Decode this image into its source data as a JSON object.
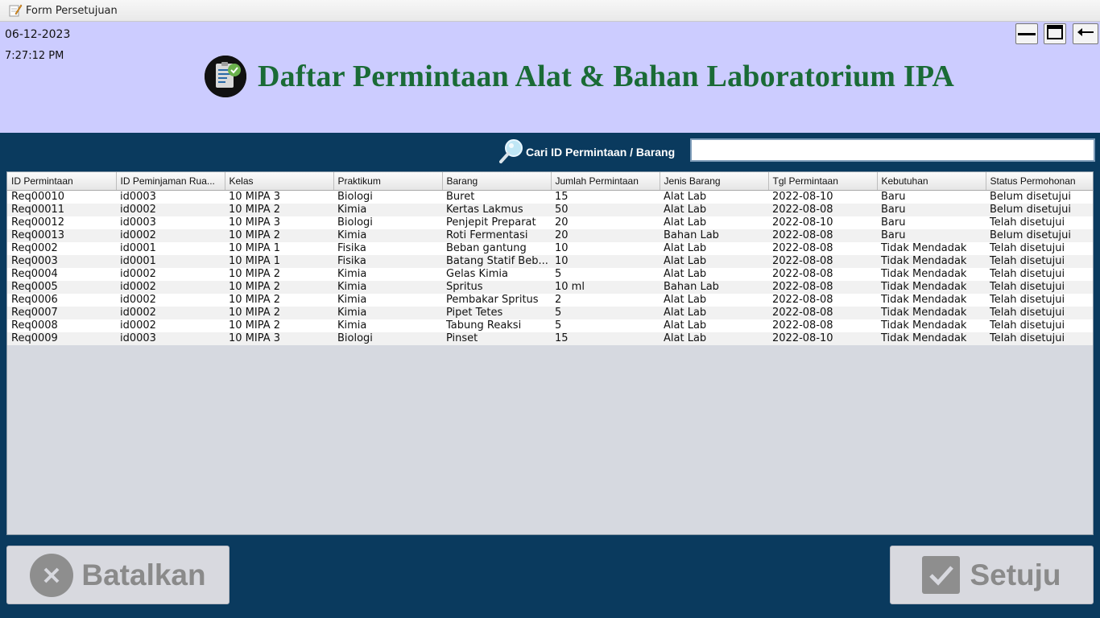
{
  "window": {
    "title": "Form Persetujuan"
  },
  "header": {
    "date": "06-12-2023",
    "time": "7:27:12 PM",
    "title": "Daftar Permintaan Alat & Bahan Laboratorium IPA"
  },
  "search": {
    "label": "Cari ID Permintaan / Barang",
    "value": ""
  },
  "table": {
    "columns": [
      "ID Permintaan",
      "ID Peminjaman Rua...",
      "Kelas",
      "Praktikum",
      "Barang",
      "Jumlah Permintaan",
      "Jenis Barang",
      "Tgl Permintaan",
      "Kebutuhan",
      "Status Permohonan"
    ],
    "rows": [
      [
        "Req00010",
        "id0003",
        "10 MIPA 3",
        "Biologi",
        "Buret",
        "15",
        "Alat Lab",
        "2022-08-10",
        "Baru",
        "Belum disetujui"
      ],
      [
        "Req00011",
        "id0002",
        "10 MIPA 2",
        "Kimia",
        "Kertas Lakmus",
        "50",
        "Alat Lab",
        "2022-08-08",
        "Baru",
        "Belum disetujui"
      ],
      [
        "Req00012",
        "id0003",
        "10 MIPA 3",
        "Biologi",
        "Penjepit Preparat",
        "20",
        "Alat Lab",
        "2022-08-10",
        "Baru",
        "Telah disetujui"
      ],
      [
        "Req00013",
        "id0002",
        "10 MIPA 2",
        "Kimia",
        "Roti Fermentasi",
        "20",
        "Bahan Lab",
        "2022-08-08",
        "Baru",
        "Belum disetujui"
      ],
      [
        "Req0002",
        "id0001",
        "10 MIPA 1",
        "Fisika",
        "Beban gantung",
        "10",
        "Alat Lab",
        "2022-08-08",
        "Tidak Mendadak",
        "Telah disetujui"
      ],
      [
        "Req0003",
        "id0001",
        "10 MIPA 1",
        "Fisika",
        "Batang Statif Beb...",
        "10",
        "Alat Lab",
        "2022-08-08",
        "Tidak Mendadak",
        "Telah disetujui"
      ],
      [
        "Req0004",
        "id0002",
        "10 MIPA 2",
        "Kimia",
        "Gelas Kimia",
        "5",
        "Alat Lab",
        "2022-08-08",
        "Tidak Mendadak",
        "Telah disetujui"
      ],
      [
        "Req0005",
        "id0002",
        "10 MIPA 2",
        "Kimia",
        "Spritus",
        "10 ml",
        "Bahan Lab",
        "2022-08-08",
        "Tidak Mendadak",
        "Telah disetujui"
      ],
      [
        "Req0006",
        "id0002",
        "10 MIPA 2",
        "Kimia",
        "Pembakar Spritus",
        "2",
        "Alat Lab",
        "2022-08-08",
        "Tidak Mendadak",
        "Telah disetujui"
      ],
      [
        "Req0007",
        "id0002",
        "10 MIPA 2",
        "Kimia",
        "Pipet Tetes",
        "5",
        "Alat Lab",
        "2022-08-08",
        "Tidak Mendadak",
        "Telah disetujui"
      ],
      [
        "Req0008",
        "id0002",
        "10 MIPA 2",
        "Kimia",
        "Tabung Reaksi",
        "5",
        "Alat Lab",
        "2022-08-08",
        "Tidak Mendadak",
        "Telah disetujui"
      ],
      [
        "Req0009",
        "id0003",
        "10 MIPA 3",
        "Biologi",
        "Pinset",
        "15",
        "Alat Lab",
        "2022-08-10",
        "Tidak Mendadak",
        "Telah disetujui"
      ]
    ]
  },
  "buttons": {
    "cancel": "Batalkan",
    "approve": "Setuju"
  },
  "colors": {
    "header_bg": "#ccccff",
    "body_bg": "#0a3a5e",
    "title_green": "#1a6b36"
  },
  "icons": [
    "app-form-icon",
    "minimize-icon",
    "maximize-icon",
    "back-arrow-icon",
    "document-check-icon",
    "search-icon",
    "cancel-icon",
    "check-icon"
  ]
}
